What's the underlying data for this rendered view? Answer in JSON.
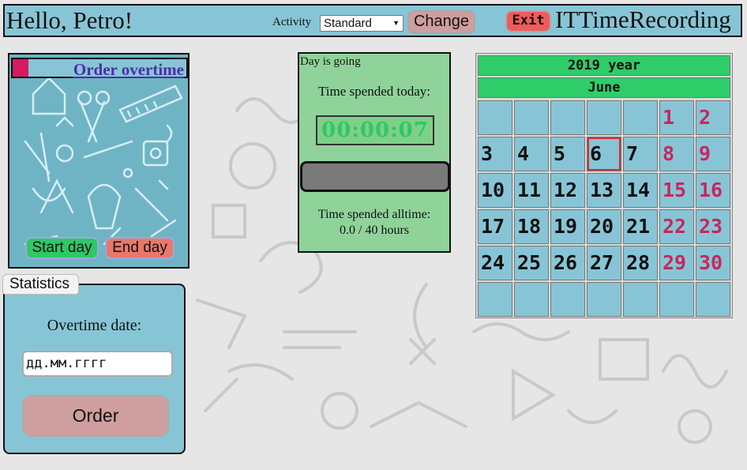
{
  "header": {
    "greeting": "Hello, Petro!",
    "activity_label": "Activity",
    "activity_selected": "Standard",
    "change_label": "Change",
    "exit_label": "Exit",
    "app_title": "ITTimeRecording"
  },
  "overtime": {
    "link_label": "Order overtime",
    "start_day_label": "Start day",
    "end_day_label": "End day"
  },
  "statistics": {
    "tab_label": "Statistics",
    "date_label": "Overtime date:",
    "date_placeholder": "дд.мм.гггг",
    "order_label": "Order"
  },
  "timer": {
    "status": "Day is going",
    "today_label": "Time spended today:",
    "clock": "00:00:07",
    "alltime_label": "Time spended alltime:",
    "alltime_value": "0.0 / 40 hours"
  },
  "calendar": {
    "year": "2019 year",
    "month": "June",
    "leading_blanks": 5,
    "days_in_month": 30,
    "trailing_blanks": 7,
    "today": 6,
    "weekend_days": [
      1,
      2,
      8,
      9,
      15,
      16,
      22,
      23,
      29,
      30
    ]
  },
  "colors": {
    "header_bg": "#87c5d6",
    "accent_green": "#2ecd6a",
    "weekend_red": "#c8265c",
    "exit_red": "#f05b5b",
    "change_pink": "#cf9e9e",
    "timer_bg": "#8fd39a"
  },
  "icons": {
    "activity_dropdown": "caret-down-icon",
    "overtime_marker": "bookmark-marker-icon"
  }
}
